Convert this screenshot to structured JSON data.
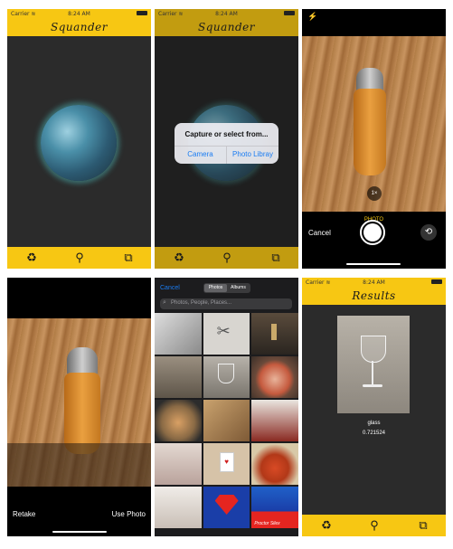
{
  "status": {
    "carrier": "Carrier ≋",
    "time": "8:24 AM"
  },
  "app": {
    "title": "Squander",
    "accent_color": "#f7c713"
  },
  "tabs": [
    {
      "name": "recycle",
      "glyph": "♻"
    },
    {
      "name": "search",
      "glyph": "⚲"
    },
    {
      "name": "categories",
      "glyph": "⧉"
    }
  ],
  "alert": {
    "message": "Capture or select from...",
    "camera_label": "Camera",
    "library_label": "Photo Libray"
  },
  "camera": {
    "flash_icon": "⚡",
    "zoom_label": "1×",
    "mode_label": "PHOTO",
    "cancel_label": "Cancel",
    "switch_icon": "⟲"
  },
  "preview": {
    "retake_label": "Retake",
    "use_label": "Use Photo"
  },
  "picker": {
    "cancel_label": "Cancel",
    "segments": [
      "Photos",
      "Albums"
    ],
    "search_placeholder": "Photos, People, Places...",
    "thumb_caption": "Proctor Silex"
  },
  "results": {
    "title": "Results",
    "label": "glass",
    "score": "0.721524"
  }
}
